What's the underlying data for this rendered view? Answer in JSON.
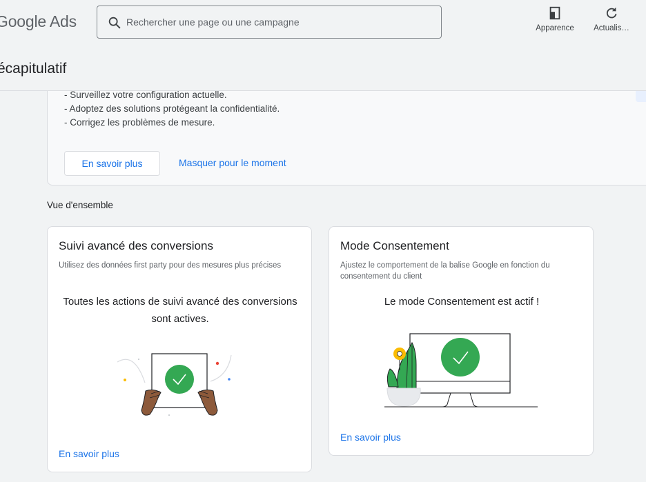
{
  "header": {
    "logo_text": "Google Ads",
    "search_placeholder": "Rechercher une page ou une campagne",
    "tools": [
      {
        "label": "Apparence",
        "icon": "appearance-icon"
      },
      {
        "label": "Actualis…",
        "icon": "refresh-icon"
      }
    ]
  },
  "page": {
    "title": "écapitulatif"
  },
  "info_card": {
    "lines": [
      "- Surveillez votre configuration actuelle.",
      "- Adoptez des solutions protégeant la confidentialité.",
      "- Corrigez les problèmes de mesure."
    ],
    "primary_button": "En savoir plus",
    "secondary_button": "Masquer pour le moment"
  },
  "overview": {
    "label": "Vue d'ensemble",
    "cards": [
      {
        "title": "Suivi avancé des conversions",
        "description": "Utilisez des données first party pour des mesures plus précises",
        "status": "Toutes les actions de suivi avancé des conversions sont actives.",
        "link": "En savoir plus",
        "illustration": "hands-holding-check-card"
      },
      {
        "title": "Mode Consentement",
        "description": "Ajustez le comportement de la balise Google en fonction du consentement du client",
        "status": "Le mode Consentement est actif !",
        "link": "En savoir plus",
        "illustration": "monitor-with-check-and-plant"
      }
    ]
  },
  "colors": {
    "accent": "#1a73e8",
    "success": "#34a853",
    "background": "#f1f3f4"
  }
}
